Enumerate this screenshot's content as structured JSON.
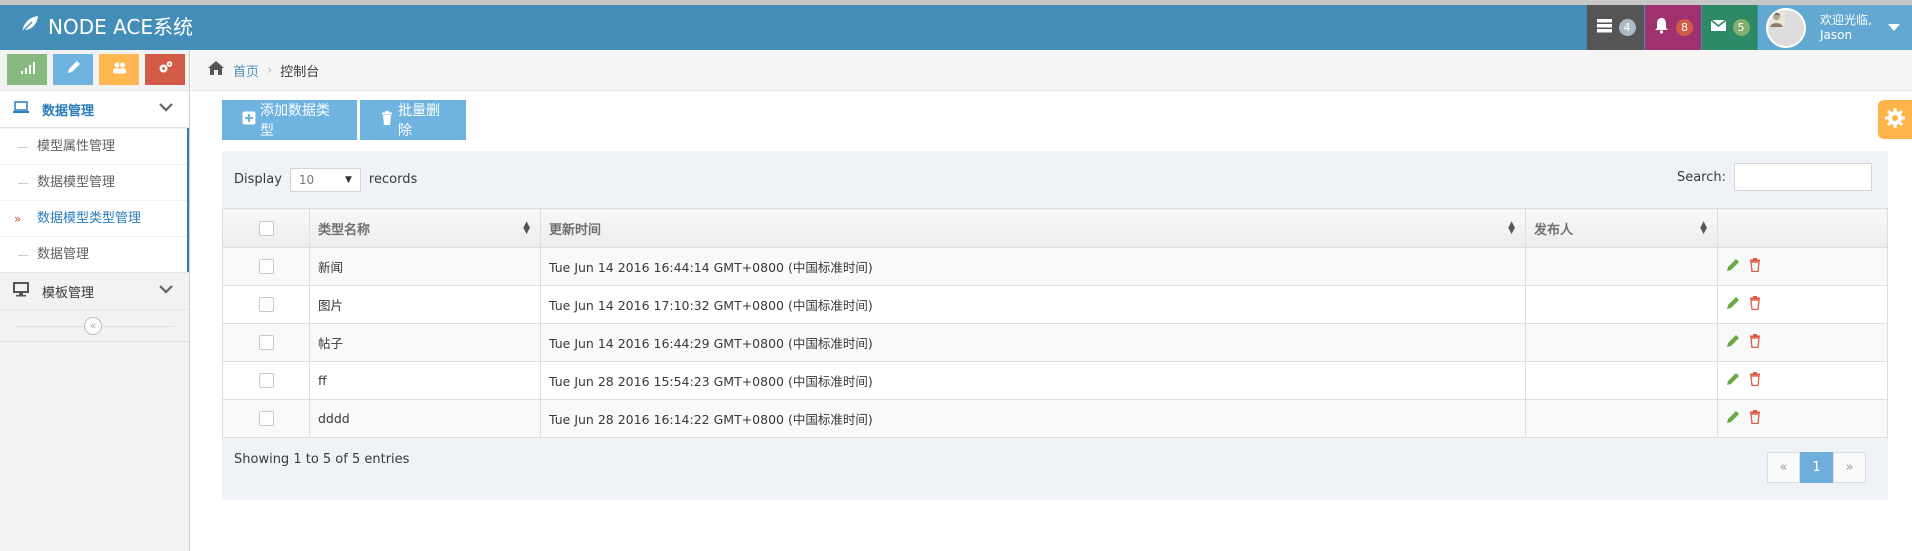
{
  "brand": {
    "title": "NODE ACE系统"
  },
  "navbar": {
    "tasks_count": "4",
    "notifications_count": "8",
    "messages_count": "5",
    "user_greeting": "欢迎光临,",
    "user_name": "Jason"
  },
  "breadcrumb": {
    "home": "首页",
    "current": "控制台"
  },
  "sidebar": {
    "menus": [
      {
        "label": "数据管理",
        "items": [
          "模型属性管理",
          "数据模型管理",
          "数据模型类型管理",
          "数据管理"
        ],
        "active_item": "数据模型类型管理"
      },
      {
        "label": "模板管理"
      }
    ]
  },
  "toolbar": {
    "add_label": "添加数据类型",
    "delete_label": "批量删除"
  },
  "datatable": {
    "display_label": "Display",
    "records_label": "records",
    "page_length": "10",
    "search_label": "Search:",
    "columns": [
      "类型名称",
      "更新时间",
      "发布人"
    ],
    "rows": [
      {
        "name": "新闻",
        "updated": "Tue Jun 14 2016 16:44:14 GMT+0800 (中国标准时间)",
        "publisher": ""
      },
      {
        "name": "图片",
        "updated": "Tue Jun 14 2016 17:10:32 GMT+0800 (中国标准时间)",
        "publisher": ""
      },
      {
        "name": "帖子",
        "updated": "Tue Jun 14 2016 16:44:29 GMT+0800 (中国标准时间)",
        "publisher": ""
      },
      {
        "name": "ff",
        "updated": "Tue Jun 28 2016 15:54:23 GMT+0800 (中国标准时间)",
        "publisher": ""
      },
      {
        "name": "dddd",
        "updated": "Tue Jun 28 2016 16:14:22 GMT+0800 (中国标准时间)",
        "publisher": ""
      }
    ],
    "info": "Showing 1 to 5 of 5 entries",
    "pagination": {
      "prev": "«",
      "current": "1",
      "next": "»"
    }
  },
  "colors": {
    "navbar": "#438eb9",
    "accent": "#6fb3e0",
    "link": "#2b7dbc",
    "edit_icon": "#69aa46",
    "delete_icon": "#dd5a43",
    "settings": "#ffb44b"
  }
}
